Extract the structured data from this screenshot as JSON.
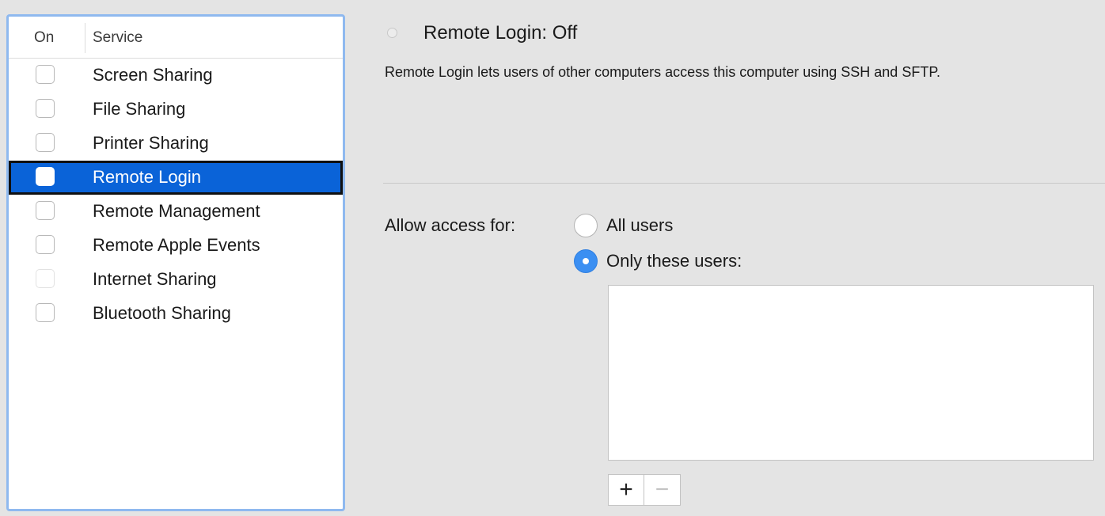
{
  "services_table": {
    "header_on": "On",
    "header_service": "Service",
    "rows": [
      {
        "label": "Screen Sharing",
        "checked": false
      },
      {
        "label": "File Sharing",
        "checked": false
      },
      {
        "label": "Printer Sharing",
        "checked": false
      },
      {
        "label": "Remote Login",
        "checked": false,
        "selected": true
      },
      {
        "label": "Remote Management",
        "checked": false
      },
      {
        "label": "Remote Apple Events",
        "checked": false
      },
      {
        "label": "Internet Sharing",
        "checked": false,
        "disabled": true
      },
      {
        "label": "Bluetooth Sharing",
        "checked": false
      }
    ]
  },
  "detail": {
    "status_title": "Remote Login: Off",
    "description": "Remote Login lets users of other computers access this computer using SSH and SFTP.",
    "access_label": "Allow access for:",
    "radio_all_label": "All users",
    "radio_only_label": "Only these users:",
    "selected_option": "only_these_users"
  },
  "users_list": {
    "items": []
  },
  "buttons": {
    "add_label": "+",
    "remove_label": "−"
  },
  "colors": {
    "selection_blue": "#0a63d8",
    "radio_blue": "#3b8ff2",
    "focus_ring": "#8fb9ef"
  },
  "icons": {
    "status": "status-off-dot-icon"
  }
}
